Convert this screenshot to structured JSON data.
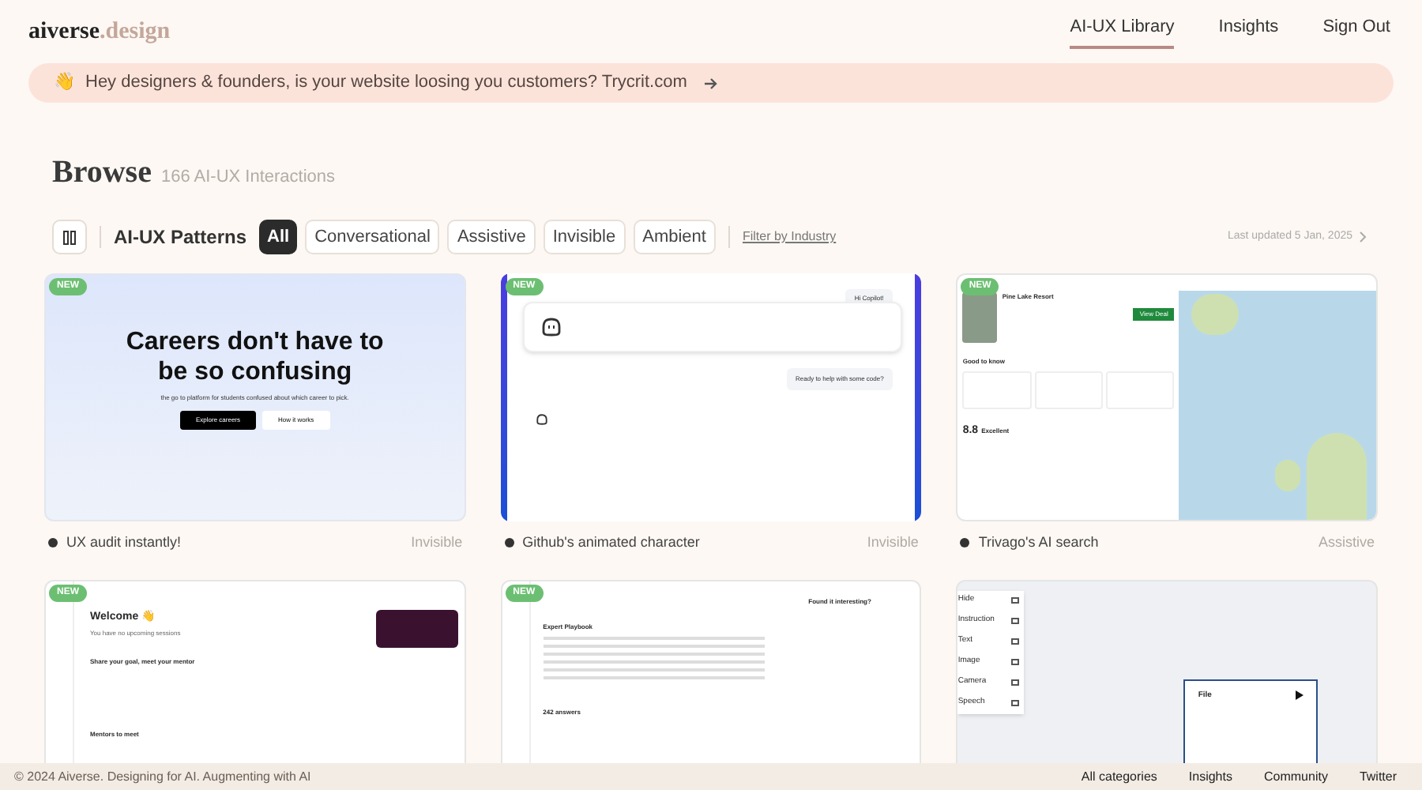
{
  "logo": {
    "primary": "aiverse",
    "secondary": ".design"
  },
  "nav": [
    {
      "label": "AI-UX Library",
      "selected": true
    },
    {
      "label": "Insights",
      "selected": false
    },
    {
      "label": "Sign Out",
      "selected": false
    }
  ],
  "banner": {
    "emoji": "👋",
    "text": "Hey designers & founders, is your website loosing you customers? Trycrit.com"
  },
  "heading": {
    "title": "Browse",
    "count": "166 AI-UX Interactions"
  },
  "filters": {
    "label": "AI-UX Patterns",
    "chips": [
      {
        "label": "All",
        "selected": true
      },
      {
        "label": "Conversational",
        "selected": false
      },
      {
        "label": "Assistive",
        "selected": false
      },
      {
        "label": "Invisible",
        "selected": false
      },
      {
        "label": "Ambient",
        "selected": false
      }
    ],
    "industry_link": "Filter by Industry",
    "updated": "Last updated 5 Jan, 2025"
  },
  "cards": [
    {
      "kind": "careers",
      "badge": "NEW",
      "title": "UX audit instantly!",
      "category": "Invisible",
      "preview": {
        "headline": "Careers don't have to be so confusing",
        "subtitle": "the go to platform for students confused about which career to pick.",
        "buttons": [
          "Explore careers",
          "How it works"
        ]
      }
    },
    {
      "kind": "chat",
      "badge": "NEW",
      "title": "Github's animated character",
      "category": "Invisible",
      "preview": {
        "messages": [
          "Hi Copilot!",
          "Ready to help with some code?"
        ]
      }
    },
    {
      "kind": "map",
      "badge": "NEW",
      "title": "Trivago's AI search",
      "category": "Assistive",
      "preview": {
        "hotel": "Pine Lake Resort",
        "deal": "View Deal",
        "section": "Good to know",
        "score": "8.8",
        "rating": "Excellent"
      }
    },
    {
      "kind": "dashboard",
      "badge": "NEW",
      "preview": {
        "welcome": "Welcome 👋",
        "subtitle": "You have no upcoming sessions",
        "goal": "Share your goal, meet your mentor",
        "mentors": "Mentors to meet"
      }
    },
    {
      "kind": "playbook",
      "badge": "NEW",
      "preview": {
        "title": "Expert Playbook",
        "answers": "242 answers",
        "side": "Found it interesting?"
      }
    },
    {
      "kind": "toolbar",
      "preview": {
        "items": [
          "Hide",
          "Instruction",
          "Text",
          "Image",
          "Camera",
          "Speech"
        ],
        "node": "File"
      }
    }
  ],
  "footer": {
    "copyright": "© 2024 Aiverse. Designing for AI. Augmenting with AI",
    "links": [
      "All categories",
      "Insights",
      "Community",
      "Twitter"
    ]
  }
}
